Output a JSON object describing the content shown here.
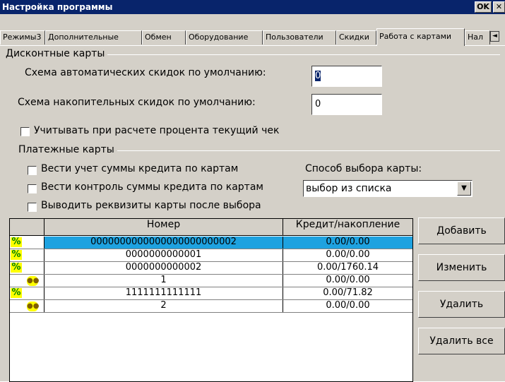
{
  "window": {
    "title": "Настройка программы",
    "ok_label": "OK",
    "close_label": "✕"
  },
  "tabs": [
    {
      "label": "Режимы3",
      "active": false
    },
    {
      "label": "Дополнительные",
      "active": false
    },
    {
      "label": "Обмен",
      "active": false
    },
    {
      "label": "Оборудование",
      "active": false
    },
    {
      "label": "Пользователи",
      "active": false
    },
    {
      "label": "Скидки",
      "active": false
    },
    {
      "label": "Работа с картами",
      "active": true
    },
    {
      "label": "Нал",
      "active": false
    }
  ],
  "tab_scroll_left": "◄",
  "discount": {
    "group_label": "Дисконтные карты",
    "auto_scheme_label": "Схема автоматических скидок по умолчанию:",
    "auto_scheme_value": "0",
    "cumulative_scheme_label": "Схема накопительных скидок по умолчанию:",
    "cumulative_scheme_value": "0",
    "consider_current_check_label": "Учитывать при расчете процента текущий чек",
    "consider_current_check_checked": false
  },
  "payment": {
    "group_label": "Платежные карты",
    "track_credit_label": "Вести учет суммы кредита по картам",
    "track_credit_checked": false,
    "control_credit_label": "Вести контроль суммы кредита по картам",
    "control_credit_checked": false,
    "show_details_label": "Выводить реквизиты карты после выбора",
    "show_details_checked": false,
    "selection_method_label": "Способ выбора карты:",
    "selection_method_value": "выбор из списка",
    "dropdown_arrow": "▼"
  },
  "table": {
    "headers": [
      "",
      "Номер",
      "Кредит/накопление"
    ],
    "rows": [
      {
        "icon": "percent",
        "number": "0000000000000000000000002",
        "credit": "0.00/0.00",
        "selected": true
      },
      {
        "icon": "percent",
        "number": "0000000000001",
        "credit": "0.00/0.00",
        "selected": false
      },
      {
        "icon": "percent",
        "number": "0000000000002",
        "credit": "0.00/1760.14",
        "selected": false
      },
      {
        "icon": "coins",
        "number": "1",
        "credit": "0.00/0.00",
        "selected": false
      },
      {
        "icon": "percent",
        "number": "1111111111111",
        "credit": "0.00/71.82",
        "selected": false
      },
      {
        "icon": "coins",
        "number": "2",
        "credit": "0.00/0.00",
        "selected": false
      }
    ]
  },
  "buttons": {
    "add": "Добавить",
    "edit": "Изменить",
    "delete": "Удалить",
    "delete_all": "Удалить все"
  },
  "colors": {
    "titlebar": "#08246b",
    "selection": "#1ea2e0",
    "window_bg": "#d4d0c8"
  }
}
